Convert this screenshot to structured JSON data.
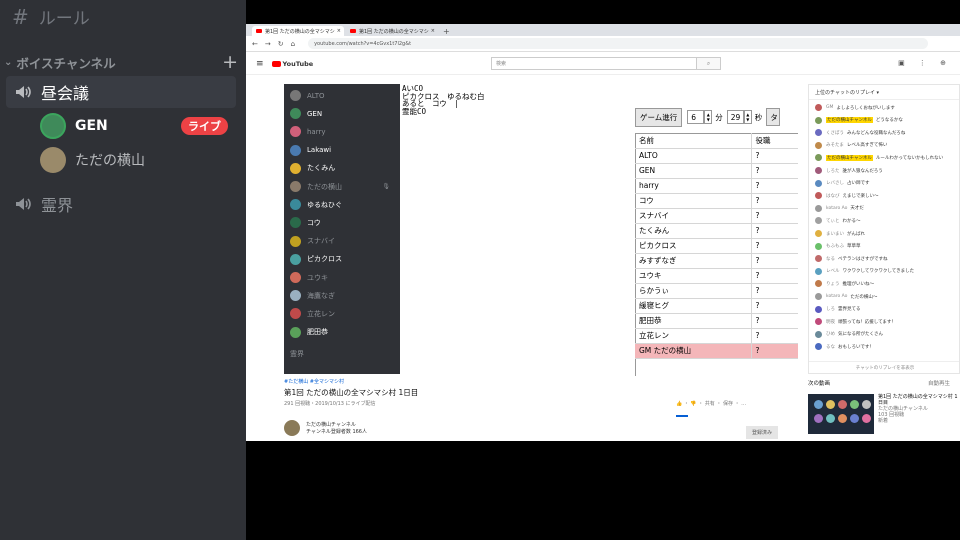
{
  "discord": {
    "text_channel": "ルール",
    "category": "ボイスチャンネル",
    "voice_channels": [
      "昼会議",
      "霊界"
    ],
    "members": [
      {
        "name": "GEN",
        "badge": "ライブ"
      },
      {
        "name": "ただの横山"
      }
    ]
  },
  "browser": {
    "tabs": [
      "第1回 ただの横山の全マシマシ",
      "第1回 ただの横山の全マシマシ"
    ],
    "url": "youtube.com/watch?v=4cGvx1t7l2g&t"
  },
  "youtube": {
    "logo": "YouTube",
    "search_placeholder": "検索",
    "video": {
      "tag": "#ただ横山 #全マシマシ村",
      "title": "第1回 ただの横山の全マシマシ村 1日目",
      "meta": "291 回視聴・2019/10/13 にライブ配信",
      "actions": "👍 ・ 👎 ・ 共有 ・ 保存 ・ …"
    },
    "channel": {
      "name": "ただの横山チャンネル",
      "subs": "チャンネル登録者数 166人"
    },
    "subscribe_label": "登録済み",
    "chat": {
      "header": "上位のチャットのリプレイ ▾",
      "messages": [
        {
          "author": "GM",
          "text": "よしよろしくおねがいします"
        },
        {
          "author": "ただの横山チャンネル",
          "text": "どうなるかな",
          "highlight": true
        },
        {
          "author": "くさぼう",
          "text": "みんなどんな役職なんだろね"
        },
        {
          "author": "みそたま",
          "text": "レベル高すぎて怖い"
        },
        {
          "author": "ただの横山チャンネル",
          "text": "ルールわかってないかもしれない",
          "highlight": true
        },
        {
          "author": "しろた",
          "text": "誰が人狼なんだろう"
        },
        {
          "author": "レバさし",
          "text": "占い師です"
        },
        {
          "author": "はなび",
          "text": "えまじで楽しい～"
        },
        {
          "author": "kotaro Ao",
          "text": "天才だ"
        },
        {
          "author": "てぃと",
          "text": "わかる～"
        },
        {
          "author": "まいまい",
          "text": "がんばれ"
        },
        {
          "author": "もふもふ",
          "text": "草草草"
        },
        {
          "author": "なる",
          "text": "ベテランはさすがですね"
        },
        {
          "author": "レベル",
          "text": "ワクワクしてワクワクしてきました"
        },
        {
          "author": "りょう",
          "text": "推理がいいね～"
        },
        {
          "author": "kotaro Ao",
          "text": "ただの横山～"
        },
        {
          "author": "しろ",
          "text": "霊界見てる"
        },
        {
          "author": "明夜",
          "text": "頑張ってね！応援してます！"
        },
        {
          "author": "ひめ",
          "text": "気になる所がたくさん"
        },
        {
          "author": "るな",
          "text": "おもしろいです！"
        }
      ],
      "footer": "チャットのリプレイを非表示"
    },
    "next": {
      "heading": "次の動画",
      "autoplay": "自動再生",
      "title": "第1回 ただの横山の全マシマシ村 1日目",
      "channel": "ただの横山チャンネル",
      "views": "103 回視聴",
      "status": "新着"
    }
  },
  "stream": {
    "voice_list": [
      {
        "name": "ALTO",
        "active": false
      },
      {
        "name": "GEN",
        "active": true
      },
      {
        "name": "harry",
        "active": false
      },
      {
        "name": "Lakawi",
        "active": true
      },
      {
        "name": "たくみん",
        "active": true
      },
      {
        "name": "ただの横山",
        "active": false,
        "muted": true
      },
      {
        "name": "ゆるねひぐ",
        "active": true
      },
      {
        "name": "コウ",
        "active": true
      },
      {
        "name": "スナバイ",
        "active": false
      },
      {
        "name": "ピカクロス",
        "active": true
      },
      {
        "name": "ユウキ",
        "active": false
      },
      {
        "name": "海鷹なぎ",
        "active": false
      },
      {
        "name": "立花レン",
        "active": false
      },
      {
        "name": "肥田恭",
        "active": true
      }
    ],
    "voice_footer": "霊界",
    "memo": "AいCO\nピカクロス　ゆるねむ白\nあると　コウ　|\n霊能CO",
    "game_button": "ゲーム進行",
    "minutes": "6",
    "minutes_unit": "分",
    "seconds": "29",
    "seconds_unit": "秒",
    "extra_button": "タ",
    "table_headers": [
      "名前",
      "役職"
    ],
    "table_rows": [
      {
        "name": "ALTO",
        "role": "?"
      },
      {
        "name": "GEN",
        "role": "?"
      },
      {
        "name": "harry",
        "role": "?"
      },
      {
        "name": "コウ",
        "role": "?"
      },
      {
        "name": "スナバイ",
        "role": "?"
      },
      {
        "name": "たくみん",
        "role": "?"
      },
      {
        "name": "ピカクロス",
        "role": "?"
      },
      {
        "name": "みすずなぎ",
        "role": "?"
      },
      {
        "name": "ユウキ",
        "role": "?"
      },
      {
        "name": "らかうぃ",
        "role": "?"
      },
      {
        "name": "緩寝ヒグ",
        "role": "?"
      },
      {
        "name": "肥田恭",
        "role": "?"
      },
      {
        "name": "立花レン",
        "role": "?"
      },
      {
        "name": "GM ただの横山",
        "role": "?",
        "gm": true
      }
    ]
  }
}
